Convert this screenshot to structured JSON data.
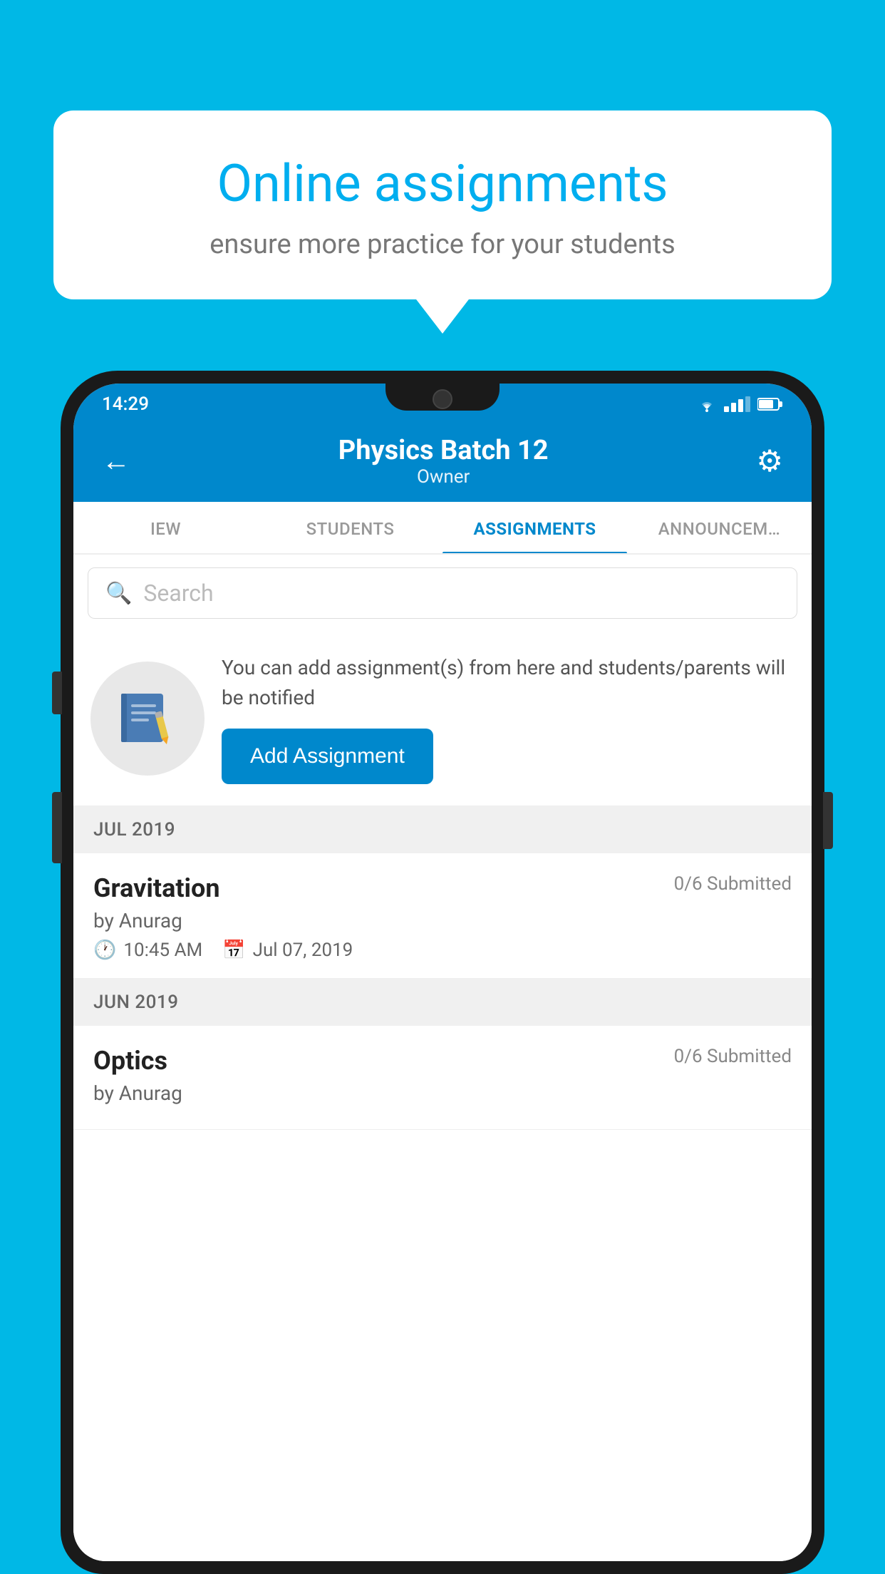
{
  "background_color": "#00B8E6",
  "speech_bubble": {
    "title": "Online assignments",
    "subtitle": "ensure more practice for your students"
  },
  "status_bar": {
    "time": "14:29",
    "wifi": "▼▲",
    "battery": "🔋"
  },
  "app_header": {
    "title": "Physics Batch 12",
    "subtitle": "Owner",
    "back_label": "←",
    "settings_label": "⚙"
  },
  "tabs": [
    {
      "label": "IEW",
      "active": false
    },
    {
      "label": "STUDENTS",
      "active": false
    },
    {
      "label": "ASSIGNMENTS",
      "active": true
    },
    {
      "label": "ANNOUNCEM…",
      "active": false
    }
  ],
  "search": {
    "placeholder": "Search"
  },
  "promo": {
    "description": "You can add assignment(s) from here and students/parents will be notified",
    "button_label": "Add Assignment"
  },
  "sections": [
    {
      "month": "JUL 2019",
      "assignments": [
        {
          "name": "Gravitation",
          "submitted": "0/6 Submitted",
          "author": "by Anurag",
          "time": "10:45 AM",
          "date": "Jul 07, 2019"
        }
      ]
    },
    {
      "month": "JUN 2019",
      "assignments": [
        {
          "name": "Optics",
          "submitted": "0/6 Submitted",
          "author": "by Anurag",
          "time": "",
          "date": ""
        }
      ]
    }
  ]
}
